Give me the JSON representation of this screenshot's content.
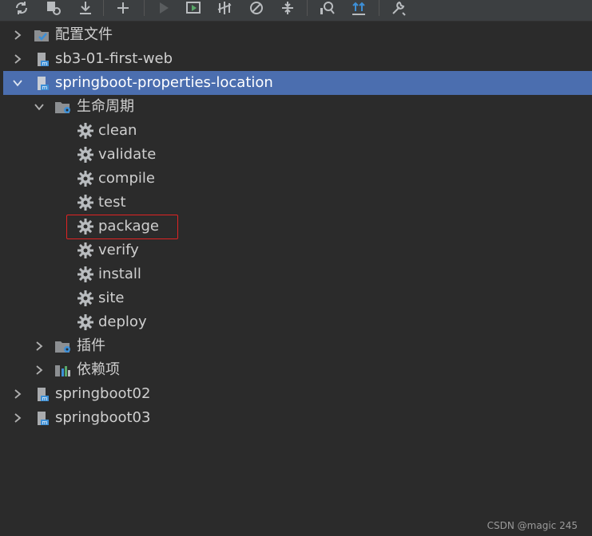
{
  "toolbar": {
    "buttons": [
      {
        "icon": "reload-icon"
      },
      {
        "icon": "generate-sources-icon"
      },
      {
        "icon": "download-icon"
      },
      {
        "icon": "add-icon"
      },
      {
        "icon": "run-icon"
      },
      {
        "icon": "execute-goal-icon"
      },
      {
        "icon": "toggle-offline-icon"
      },
      {
        "icon": "skip-tests-icon"
      },
      {
        "icon": "collapse-icon"
      },
      {
        "icon": "show-dependencies-icon"
      },
      {
        "icon": "analyze-icon"
      },
      {
        "icon": "settings-wrench-icon"
      }
    ]
  },
  "tree": {
    "root_items": [
      {
        "label": "配置文件",
        "icon": "profiles-icon"
      },
      {
        "label": "sb3-01-first-web",
        "icon": "maven-module-icon"
      },
      {
        "label": "springboot-properties-location",
        "icon": "maven-module-icon",
        "selected": true
      },
      {
        "label": "springboot02",
        "icon": "maven-module-icon"
      },
      {
        "label": "springboot03",
        "icon": "maven-module-icon"
      }
    ],
    "lifecycle": {
      "label": "生命周期"
    },
    "lifecycle_goals": [
      "clean",
      "validate",
      "compile",
      "test",
      "package",
      "verify",
      "install",
      "site",
      "deploy"
    ],
    "plugins": {
      "label": "插件"
    },
    "dependencies": {
      "label": "依赖项"
    },
    "highlighted_goal": "package"
  },
  "watermark": "CSDN @magic 245",
  "colors": {
    "background": "#2b2b2b",
    "selection": "#4b6eaf",
    "highlight_border": "#e02323",
    "gear": "#b9bcbf",
    "maven_blue": "#3d8fd6"
  }
}
